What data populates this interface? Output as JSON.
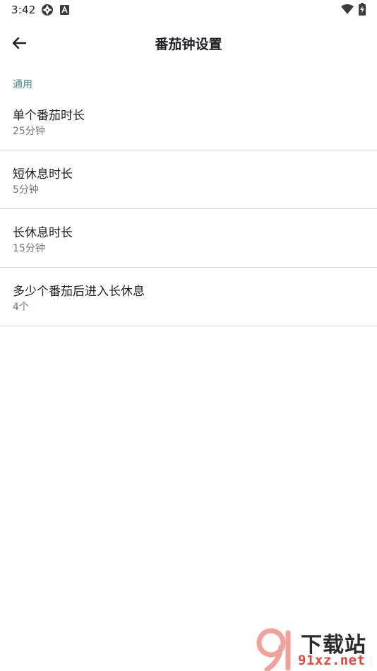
{
  "status_bar": {
    "time": "3:42",
    "icons": [
      "aperture-icon",
      "a-badge-icon",
      "wifi-icon",
      "battery-charging-icon"
    ]
  },
  "app_bar": {
    "title": "番茄钟设置",
    "back_icon": "arrow-left-icon"
  },
  "section": {
    "header": "通用",
    "items": [
      {
        "title": "单个番茄时长",
        "value": "25分钟"
      },
      {
        "title": "短休息时长",
        "value": "5分钟"
      },
      {
        "title": "长休息时长",
        "value": "15分钟"
      },
      {
        "title": "多少个番茄后进入长休息",
        "value": "4个"
      }
    ]
  },
  "watermark": {
    "line1": "下载站",
    "line2": "91xz.net",
    "color": "#e8453c"
  },
  "colors": {
    "accent": "#3f8f8b",
    "divider": "#d9d9d9",
    "secondary_text": "#757575"
  }
}
